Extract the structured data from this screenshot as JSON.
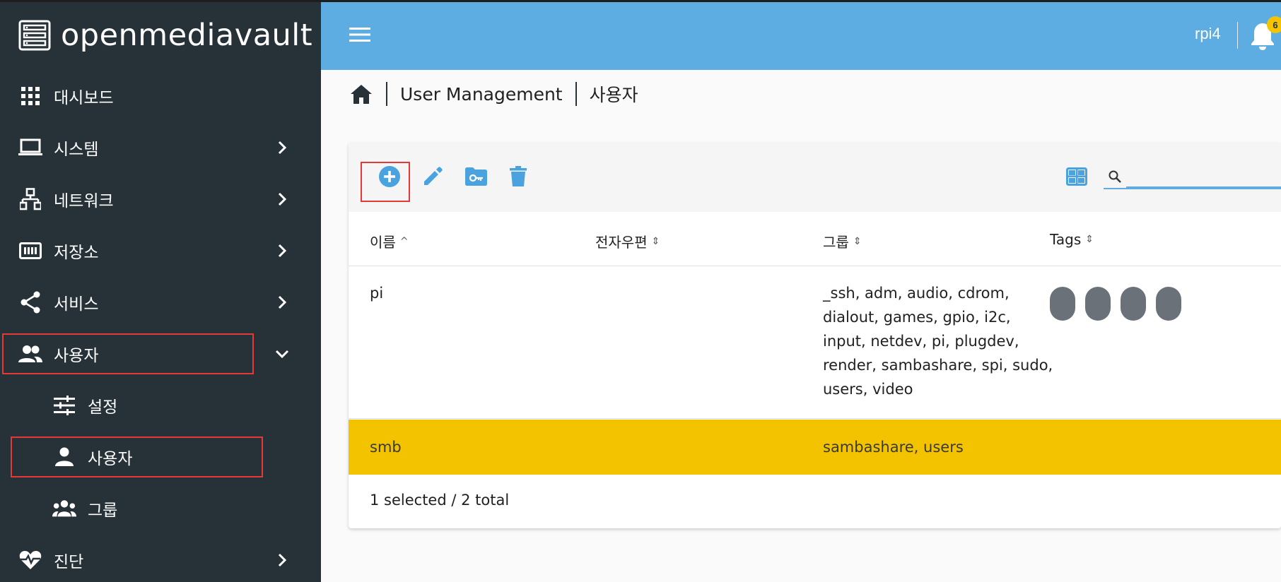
{
  "app": {
    "brand": "openmediavault",
    "host": "rpi4",
    "notification_count": "6"
  },
  "colors": {
    "sidebar_bg": "#263238",
    "topbar_bg": "#5dade2",
    "accent": "#5dade2",
    "selected_row": "#f4c300",
    "highlight_box": "#e53935"
  },
  "sidebar": {
    "items": [
      {
        "label": "대시보드",
        "icon": "dashboard-grid-icon"
      },
      {
        "label": "시스템",
        "icon": "laptop-icon"
      },
      {
        "label": "네트워크",
        "icon": "network-icon"
      },
      {
        "label": "저장소",
        "icon": "storage-icon"
      },
      {
        "label": "서비스",
        "icon": "share-icon"
      },
      {
        "label": "사용자",
        "icon": "users-icon",
        "expanded": true
      },
      {
        "label": "진단",
        "icon": "heartbeat-icon"
      }
    ],
    "subitems": [
      {
        "label": "설정",
        "icon": "tune-icon"
      },
      {
        "label": "사용자",
        "icon": "person-icon",
        "active": true
      },
      {
        "label": "그룹",
        "icon": "group-icon"
      }
    ]
  },
  "breadcrumb": {
    "items": [
      "User Management",
      "사용자"
    ]
  },
  "toolbar": {
    "buttons": [
      "add-circle-icon",
      "edit-pencil-icon",
      "folder-key-icon",
      "delete-trash-icon"
    ],
    "search_placeholder": ""
  },
  "table": {
    "columns": [
      {
        "label": "이름",
        "sort": "^"
      },
      {
        "label": "전자우편",
        "sort": "⇕"
      },
      {
        "label": "그룹",
        "sort": "⇕"
      },
      {
        "label": "Tags",
        "sort": "⇕"
      }
    ],
    "rows": [
      {
        "name": "pi",
        "email": "",
        "groups_lines": [
          "_ssh, adm, audio, cdrom,",
          "dialout, games, gpio, i2c,",
          "input, netdev, pi, plugdev,",
          "render, sambashare, spi, sudo,",
          "users, video"
        ],
        "selected": false
      },
      {
        "name": "smb",
        "email": "",
        "groups": "sambashare, users",
        "selected": true
      }
    ],
    "footer": "1 selected / 2 total"
  }
}
